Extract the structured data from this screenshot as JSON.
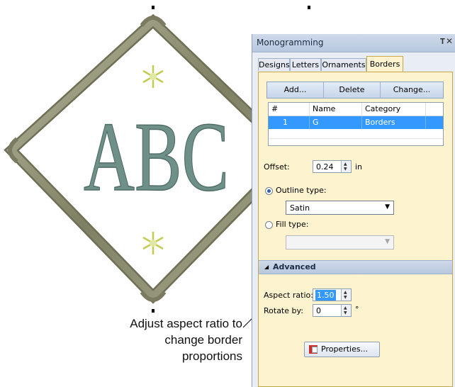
{
  "canvas": {
    "design_letters": "ABC",
    "callout_lines": [
      "Adjust aspect ratio to",
      "change border",
      "proportions"
    ]
  },
  "panel": {
    "title": "Monogramming",
    "pin_icon": "pin-icon",
    "close_icon": "close-icon",
    "tabs": [
      "Designs",
      "Letters",
      "Ornaments",
      "Borders"
    ],
    "active_tab": "Borders",
    "toolbar": {
      "add_label": "Add...",
      "delete_label": "Delete",
      "change_label": "Change..."
    },
    "table": {
      "columns": [
        "#",
        "Name",
        "Category"
      ],
      "rows": [
        {
          "num": "1",
          "name": "G",
          "category": "Borders"
        }
      ]
    },
    "offset": {
      "label": "Offset:",
      "value": "0.24",
      "unit": "in"
    },
    "outline": {
      "label": "Outline type:",
      "selected": true,
      "value": "Satin"
    },
    "fill": {
      "label": "Fill type:",
      "selected": false,
      "value": ""
    },
    "advanced": {
      "title": "Advanced",
      "aspect_ratio": {
        "label": "Aspect ratio:",
        "value": "1.50"
      },
      "rotate_by": {
        "label": "Rotate by:",
        "value": "0",
        "unit": "°"
      }
    },
    "properties_label": "Properties..."
  },
  "colors": {
    "thread": "#6e9088",
    "border_satin": "#8a8b70",
    "star": "#cfd66a",
    "panel_bg": "#fdf3cf",
    "selection": "#3399ff"
  }
}
